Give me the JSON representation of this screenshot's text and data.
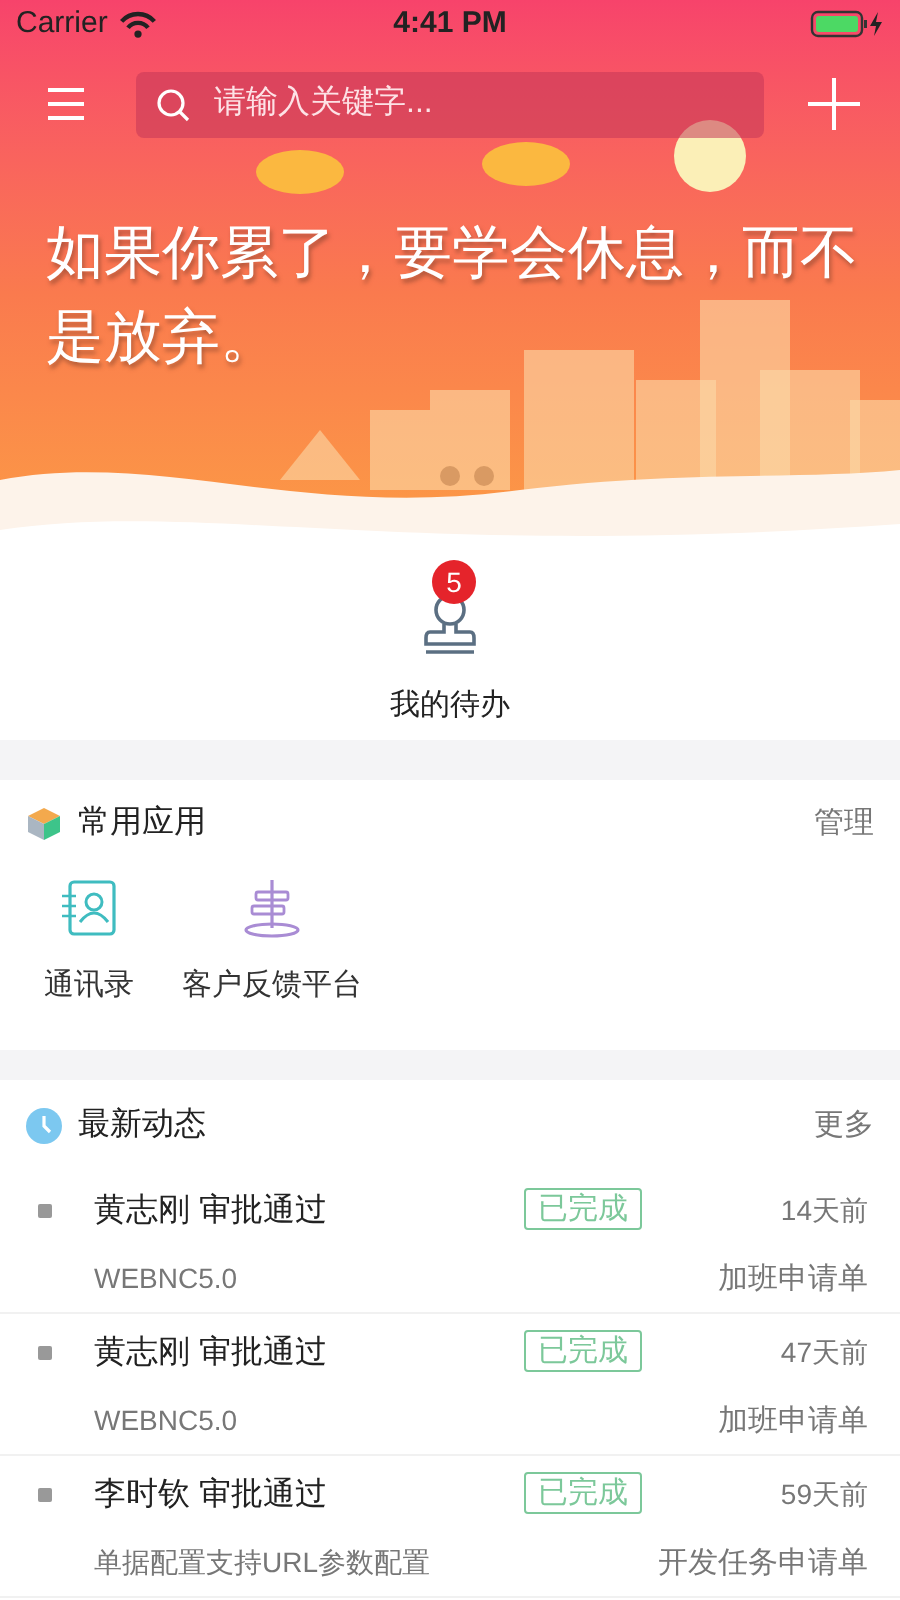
{
  "status_bar": {
    "carrier": "Carrier",
    "time": "4:41 PM"
  },
  "search": {
    "placeholder": "请输入关键字..."
  },
  "banner": {
    "quote": "如果你累了，要学会休息，而不是放弃。"
  },
  "todo": {
    "label": "我的待办",
    "badge": "5"
  },
  "apps": {
    "title": "常用应用",
    "action": "管理",
    "items": [
      {
        "label": "通讯录",
        "kind": "contacts"
      },
      {
        "label": "客户反馈平台",
        "kind": "feedback"
      }
    ]
  },
  "news": {
    "title": "最新动态",
    "action": "更多",
    "items": [
      {
        "title": "黄志刚 审批通过",
        "status": "已完成",
        "time": "14天前",
        "project": "WEBNC5.0",
        "form": "加班申请单"
      },
      {
        "title": "黄志刚 审批通过",
        "status": "已完成",
        "time": "47天前",
        "project": "WEBNC5.0",
        "form": "加班申请单"
      },
      {
        "title": "李时钦 审批通过",
        "status": "已完成",
        "time": "59天前",
        "project": "单据配置支持URL参数配置",
        "form": "开发任务申请单"
      }
    ]
  }
}
